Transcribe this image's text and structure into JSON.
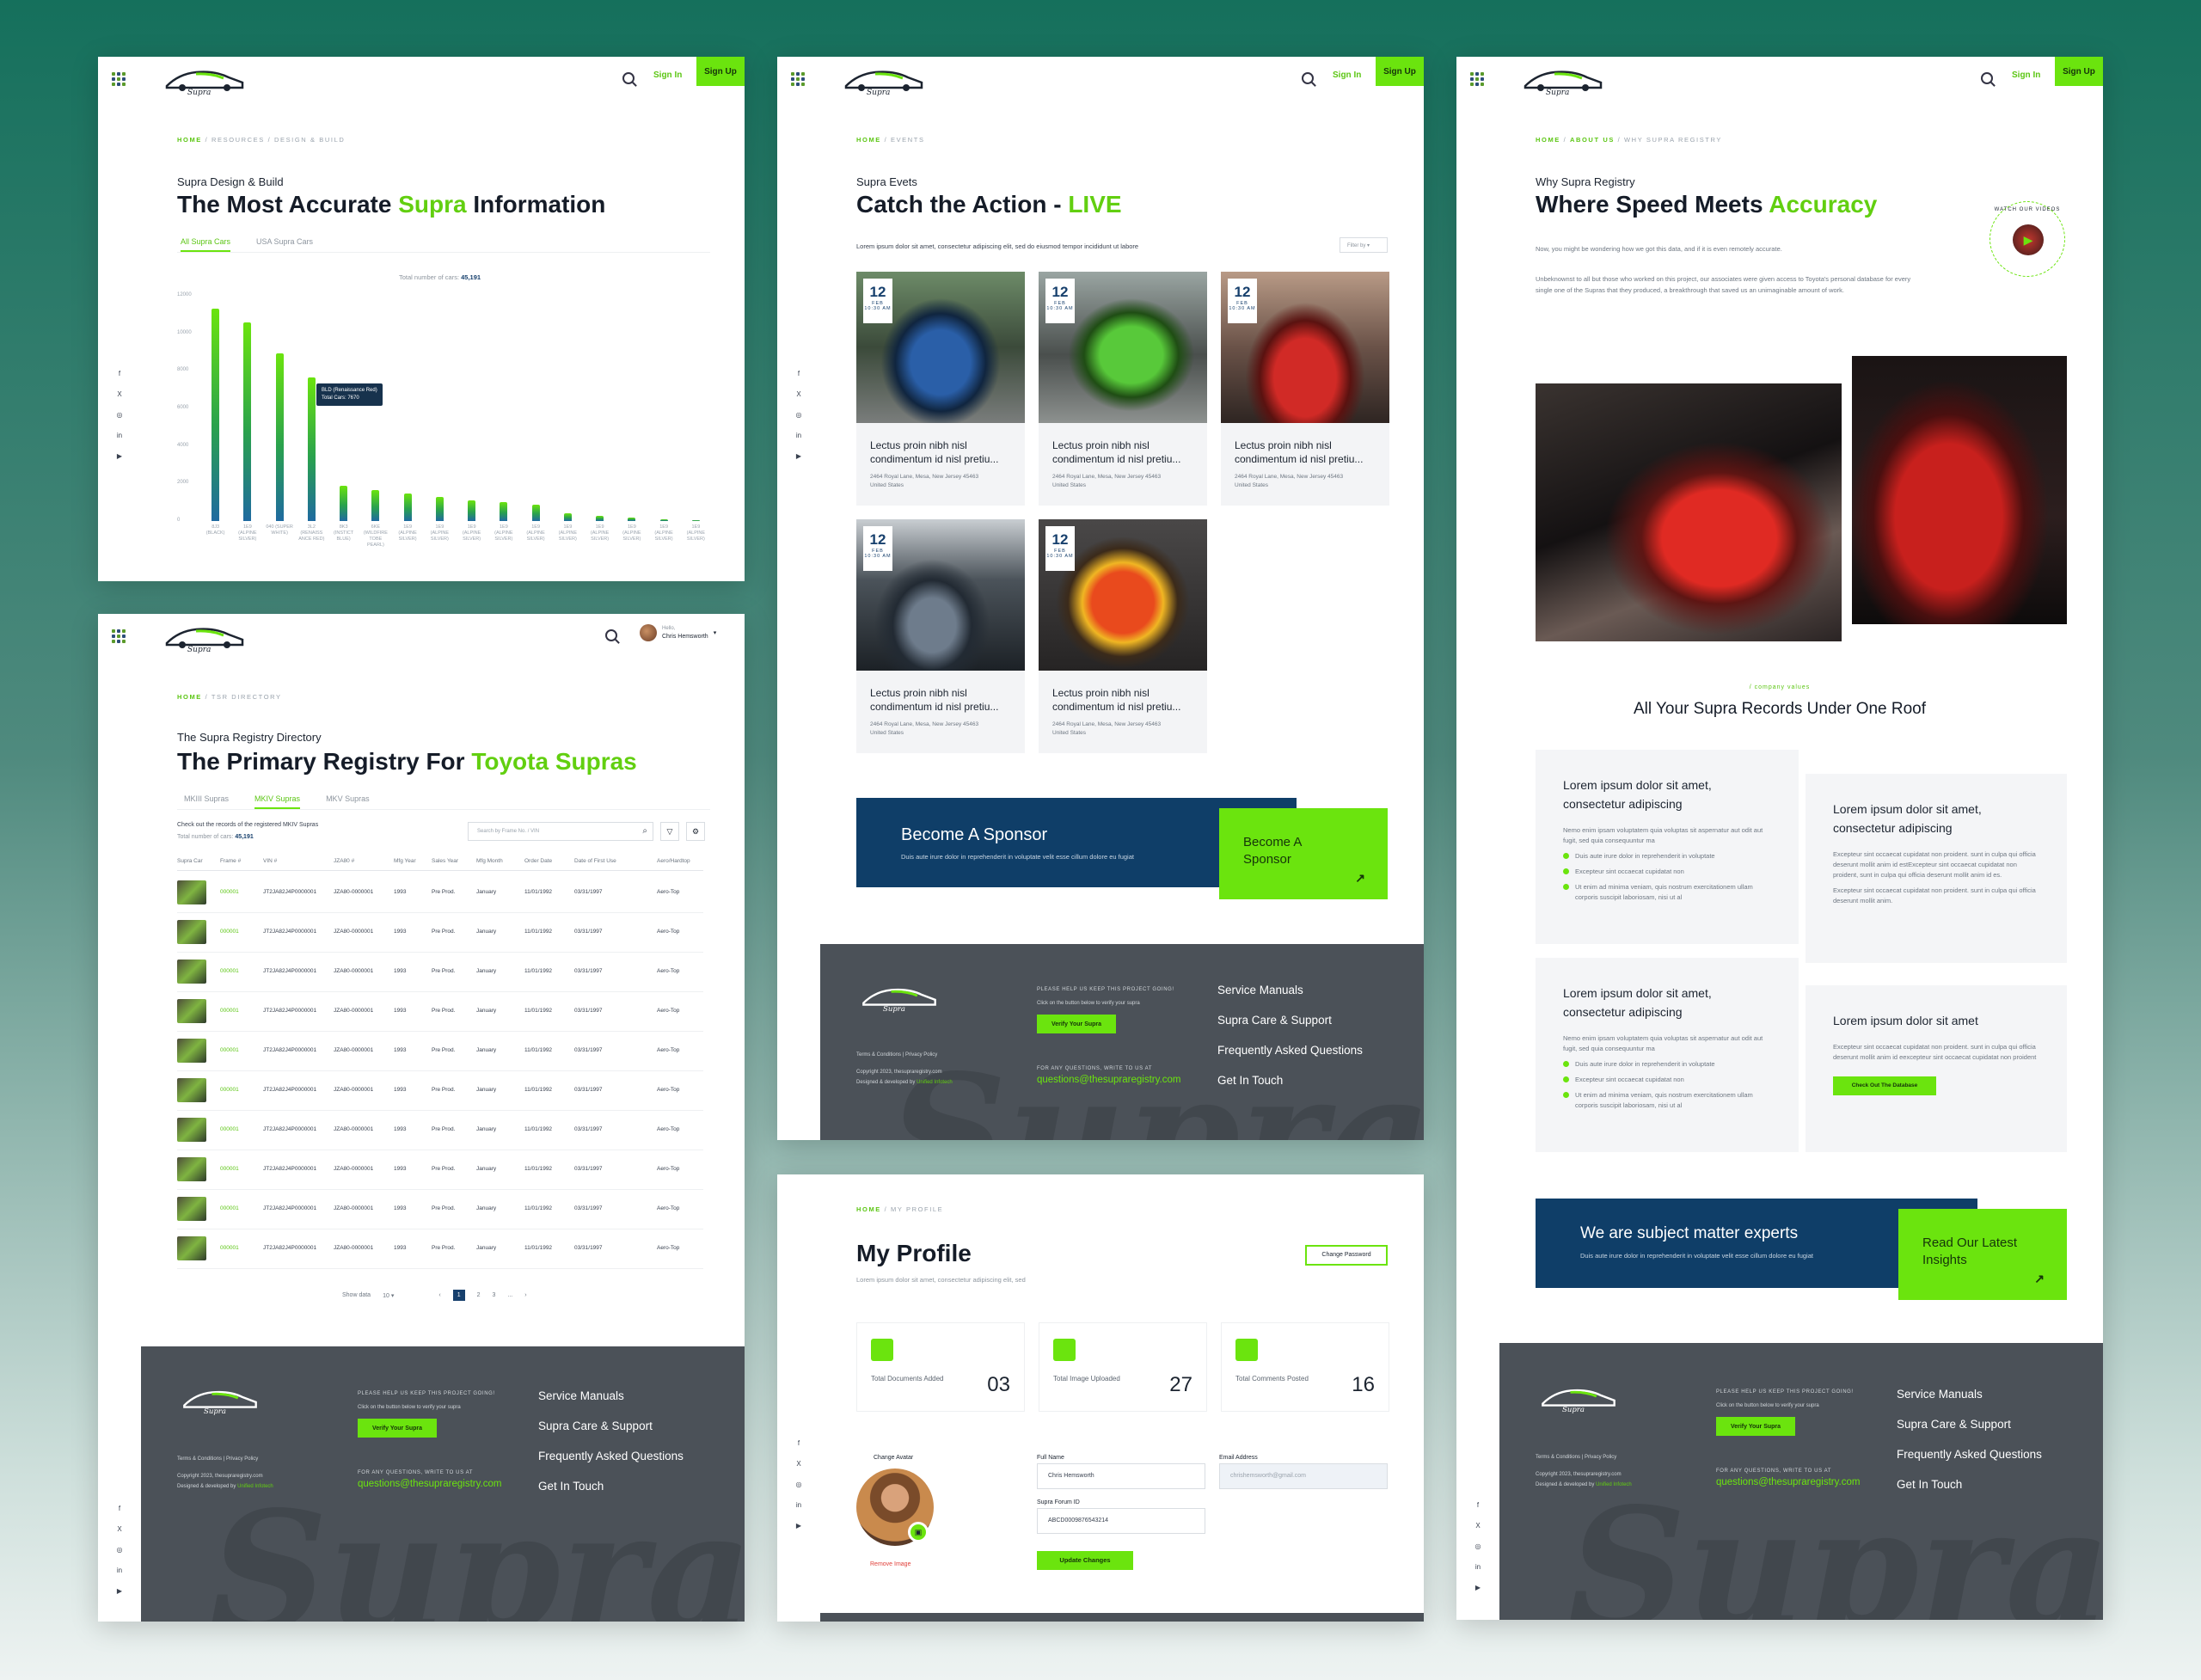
{
  "colors": {
    "accent": "#6be40e",
    "navy": "#0f3e68",
    "footer": "#4b5158"
  },
  "header": {
    "sign_in": "Sign In",
    "sign_up": "Sign Up",
    "logo_text": "THE Supra REGISTRY"
  },
  "social": [
    "f",
    "X",
    "◎",
    "in",
    "▶"
  ],
  "footer": {
    "help_text": "PLEASE HELP US KEEP THIS PROJECT GOING!",
    "verify_hint": "Click on the button below to verify your supra",
    "verify_button": "Verify Your Supra",
    "questions": "FOR ANY QUESTIONS, WRITE TO US AT",
    "email": "questions@thesupraregistry.com",
    "terms": "Terms & Conditions",
    "privacy": "Privacy Policy",
    "copyright": "Copyright 2023, thesupraregistry.com",
    "designed": "Designed & developed by",
    "designer": "Unified Infotech",
    "links": [
      "Service Manuals",
      "Supra Care & Support",
      "Frequently Asked Questions",
      "Get In Touch"
    ]
  },
  "design": {
    "crumb": [
      "HOME",
      "RESOURCES",
      "DESIGN & BUILD"
    ],
    "kicker": "Supra Design & Build",
    "title_a": "The Most Accurate ",
    "title_b": "Supra",
    "title_c": " Information",
    "tabs": [
      "All Supra Cars",
      "USA Supra Cars"
    ],
    "total_label": "Total number of cars:",
    "total_value": "45,191",
    "tooltip_line1": "BLD (Renaissance Red)",
    "tooltip_line2": "Total Cars: 7670"
  },
  "chart_data": {
    "type": "bar",
    "categories": [
      "8J3 (BLACK)",
      "1E9 (ALPINE SILVER)",
      "040 (SUPER WHITE)",
      "3L2 (RENAISS ANCE RED)",
      "8K3 (INSTICT BLUE)",
      "6KE (WILDFIRE TOBE PEARL)",
      "1E9 (ALPINE SILVER)",
      "1E9 (ALPINE SILVER)",
      "1E9 (ALPINE SILVER)",
      "1E9 (ALPINE SILVER)",
      "1E9 (ALPINE SILVER)",
      "1E9 (ALPINE SILVER)",
      "1E9 (ALPINE SILVER)",
      "1E9 (ALPINE SILVER)",
      "1E9 (ALPINE SILVER)",
      "1E9 (ALPINE SILVER)"
    ],
    "values": [
      11300,
      10600,
      8950,
      7670,
      1900,
      1650,
      1450,
      1300,
      1120,
      1000,
      850,
      420,
      280,
      170,
      90,
      50
    ],
    "yticks": [
      "12000",
      "10000",
      "8000",
      "6000",
      "4000",
      "2000",
      "0"
    ],
    "ylim": [
      0,
      12000
    ]
  },
  "registry": {
    "user": "Chris Hemsworth",
    "user_greet": "Hello,",
    "crumb": [
      "HOME",
      "TSR DIRECTORY"
    ],
    "kicker": "The Supra Registry Directory",
    "title_a": "The Primary Registry For ",
    "title_b": "Toyota Supras",
    "tabs": [
      "MKIII Supras",
      "MKIV Supras",
      "MKV Supras"
    ],
    "desc": "Check out the records of the registered MKIV Supras",
    "total_label": "Total number of cars:",
    "total_value": "45,191",
    "search_placeholder": "Search by Frame No. / VIN",
    "columns": [
      "Supra Car",
      "Frame #",
      "VIN #",
      "JZA80 #",
      "Mfg Year",
      "Sales Year",
      "Mfg Month",
      "Order Date",
      "Date of First Use",
      "Aero/Hardtop"
    ],
    "row": [
      "000001",
      "JT2JA82J4P0000001",
      "JZA80-0000001",
      "1993",
      "Pre Prod.",
      "January",
      "11/01/1992",
      "03/31/1997",
      "Aero-Top"
    ],
    "row_count": 10,
    "show_label": "Show data",
    "show_value": "10",
    "pages": [
      "‹",
      "1",
      "2",
      "3",
      "...",
      "›"
    ]
  },
  "events": {
    "crumb": [
      "HOME",
      "EVENTS"
    ],
    "kicker": "Supra Evets",
    "title_a": "Catch the Action - ",
    "title_b": "LIVE",
    "intro": "Lorem ipsum dolor sit amet, consectetur adipiscing elit, sed do eiusmod tempor incididunt ut labore",
    "filter": "Filter by",
    "card": {
      "day": "12",
      "month": "FEB",
      "time": "10:30 AM",
      "title": "Lectus proin nibh nisl condimentum id nisl pretiu...",
      "addr": "2464 Royal Lane, Mesa, New Jersey 45463",
      "country": "United States"
    },
    "sponsor_title": "Become A Sponsor",
    "sponsor_text": "Duis aute irure dolor in reprehenderit in voluptate velit esse cillum dolore eu fugiat",
    "sponsor_cta": "Become A Sponsor"
  },
  "profile": {
    "crumb": [
      "HOME",
      "MY PROFILE"
    ],
    "title": "My Profile",
    "subtitle": "Lorem ipsum dolor sit amet, consectetur adipiscing elit, sed",
    "change_password": "Change Password",
    "stats": [
      {
        "label": "Total Documents Added",
        "value": "03"
      },
      {
        "label": "Total Image Uploaded",
        "value": "27"
      },
      {
        "label": "Total Comments Posted",
        "value": "16"
      }
    ],
    "change_avatar": "Change Avatar",
    "remove_image": "Remove Image",
    "full_name_label": "Full Name",
    "full_name": "Chris Hemsworth",
    "email_label": "Email Address",
    "email": "chrishemsworth@gmail.com",
    "forum_label": "Supra Forum ID",
    "forum_id": "ABCD0009876543214",
    "update": "Update Changes"
  },
  "about": {
    "crumb": [
      "HOME",
      "ABOUT US",
      "WHY SUPRA REGISTRY"
    ],
    "kicker": "Why Supra Registry",
    "title_a": "Where Speed Meets ",
    "title_b": "Accuracy",
    "p1": "Now, you might be wondering how we got this data, and if it is even remotely accurate.",
    "p2": "Unbeknownst to all but those who worked on this project, our associates were given access to Toyota's personal database for every single one of the Supras that they produced, a breakthrough that saved us an unimaginable amount of work.",
    "badge": "WATCH OUR VIDEOS",
    "values_kicker": "/ company values",
    "values_title": "All Your Supra Records Under One Roof",
    "card1_title": "Lorem ipsum dolor sit amet, consectetur adipiscing",
    "card1_text": "Nemo enim ipsam voluptatem quia voluptas sit aspernatur aut odit aut fugit, sed quia consequuntur ma",
    "card1_li1": "Duis aute irure dolor in reprehenderit in voluptate",
    "card1_li2": "Excepteur sint occaecat cupidatat non",
    "card1_li3": "Ut enim ad minima veniam, quis nostrum exercitationem ullam corporis suscipit laboriosam, nisi ut al",
    "card2_title": "Lorem ipsum dolor sit amet, consectetur adipiscing",
    "card2_text1": "Excepteur sint occaecat cupidatat non proident. sunt in culpa qui officia deserunt mollit anim id estExcepteur sint occaecat cupidatat non proident, sunt in culpa qui officia deserunt mollit anim id es.",
    "card2_text2": "Excepteur sint occaecat cupidatat non proident. sunt in culpa qui officia deserunt mollit anim.",
    "card4_title": "Lorem ipsum dolor sit amet",
    "card4_text": "Excepteur sint occaecat cupidatat non proident. sunt in culpa qui officia deserunt mollit anim id eexcepteur sint occaecat cupidatat non proident",
    "card4_button": "Check Out The Database",
    "experts_title": "We are subject matter experts",
    "experts_text": "Duis aute irure dolor in reprehenderit in voluptate velit esse cillum dolore eu fugiat",
    "experts_cta": "Read Our Latest Insights"
  }
}
